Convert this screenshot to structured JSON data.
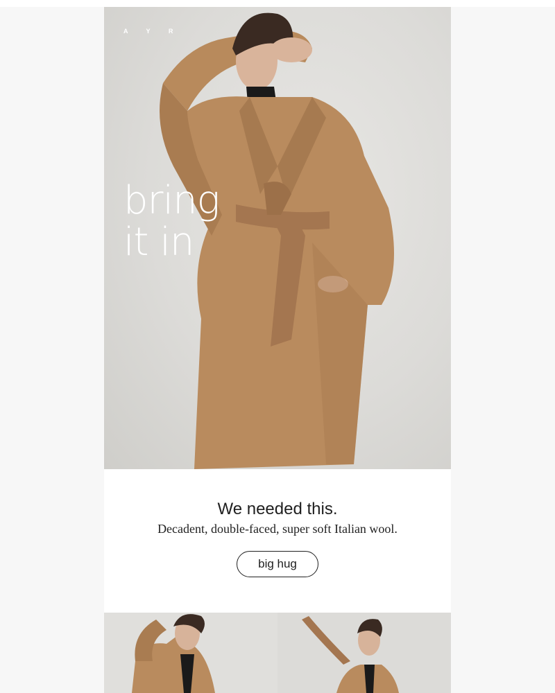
{
  "brand": {
    "logo_text": "A Y R"
  },
  "hero": {
    "headline_line1": "bring",
    "headline_line2": "it in",
    "image_subject": "model-in-camel-wrap-coat"
  },
  "copy": {
    "title": "We needed this.",
    "subtitle": "Decadent, double-faced, super soft Italian wool.",
    "cta_label": "big hug"
  },
  "tiles": [
    {
      "image_subject": "model-arm-raised-camel-coat"
    },
    {
      "image_subject": "model-belt-flying-camel-coat"
    }
  ],
  "colors": {
    "page_bg": "#f7f7f7",
    "coat": "#b98b5e",
    "text": "#1f1f1f"
  }
}
